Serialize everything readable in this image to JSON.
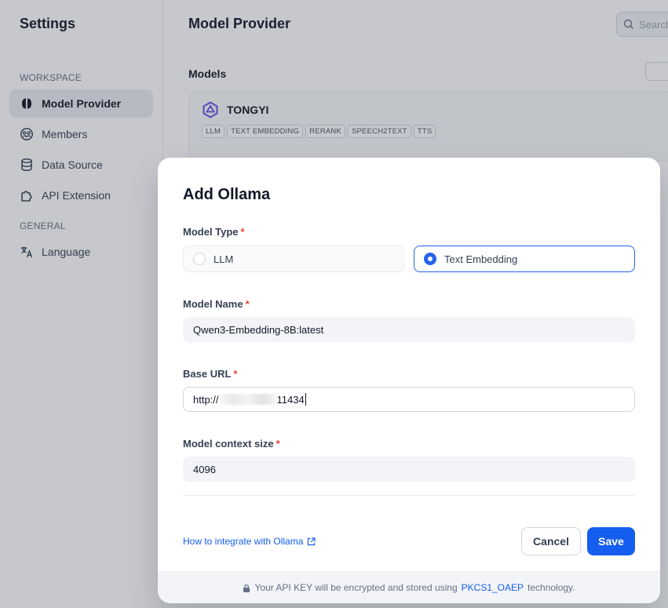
{
  "sidebar": {
    "title": "Settings",
    "workspace_label": "WORKSPACE",
    "general_label": "GENERAL",
    "items": [
      {
        "label": "Model Provider",
        "icon": "brain-icon"
      },
      {
        "label": "Members",
        "icon": "members-icon"
      },
      {
        "label": "Data Source",
        "icon": "database-icon"
      },
      {
        "label": "API Extension",
        "icon": "puzzle-icon"
      },
      {
        "label": "Language",
        "icon": "translate-icon"
      }
    ]
  },
  "main": {
    "title": "Model Provider",
    "search_placeholder": "Search",
    "models_label": "Models",
    "provider": {
      "name": "TONGYI",
      "tags": [
        "LLM",
        "TEXT EMBEDDING",
        "RERANK",
        "SPEECH2TEXT",
        "TTS"
      ]
    }
  },
  "modal": {
    "title": "Add Ollama",
    "model_type": {
      "label": "Model Type",
      "required_mark": "*",
      "options": [
        {
          "label": "LLM",
          "selected": false
        },
        {
          "label": "Text Embedding",
          "selected": true
        }
      ]
    },
    "model_name": {
      "label": "Model Name",
      "required_mark": "*",
      "value": "Qwen3-Embedding-8B:latest"
    },
    "base_url": {
      "label": "Base URL",
      "required_mark": "*",
      "value_prefix": "http://",
      "value_suffix": "11434"
    },
    "context_size": {
      "label": "Model context size",
      "required_mark": "*",
      "value": "4096"
    },
    "help_link": "How to integrate with Ollama",
    "cancel_label": "Cancel",
    "save_label": "Save",
    "footer": {
      "text_before": "Your API KEY will be encrypted and stored using",
      "link": "PKCS1_OAEP",
      "text_after": "technology."
    }
  },
  "colors": {
    "accent": "#155eef",
    "required": "#f04438",
    "overlay": "rgba(52,58,72,0.28)"
  }
}
